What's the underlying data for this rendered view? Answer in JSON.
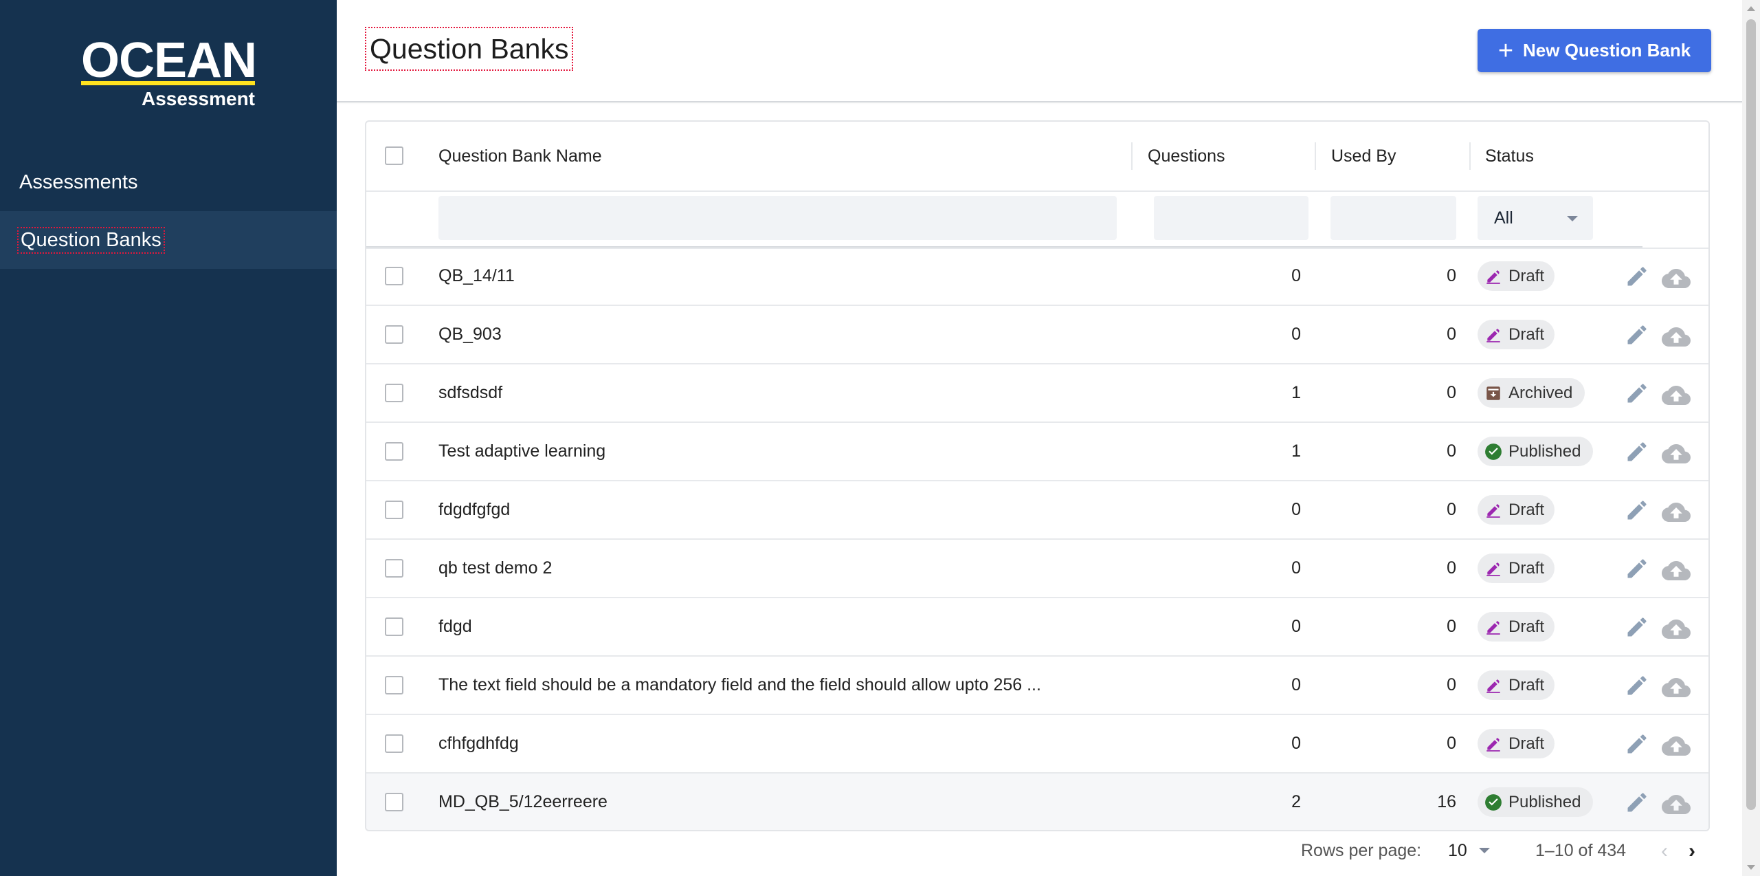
{
  "brand": {
    "name": "OCEAN",
    "tagline": "Assessment",
    "accent": "#ffe21f"
  },
  "sidebar": {
    "bg": "#15324f",
    "items": [
      {
        "label": "Assessments",
        "active": false
      },
      {
        "label": "Question Banks",
        "active": true
      }
    ]
  },
  "header": {
    "title": "Question Banks",
    "new_button_label": "New Question Bank",
    "new_button_icon": "plus-icon",
    "accent": "#3f6ee3"
  },
  "table": {
    "columns": [
      "Question Bank Name",
      "Questions",
      "Used By",
      "Status"
    ],
    "status_filter": "All",
    "rows": [
      {
        "name": "QB_14/11",
        "questions": "0",
        "used_by": "0",
        "status": "Draft"
      },
      {
        "name": "QB_903",
        "questions": "0",
        "used_by": "0",
        "status": "Draft"
      },
      {
        "name": "sdfsdsdf",
        "questions": "1",
        "used_by": "0",
        "status": "Archived"
      },
      {
        "name": "Test adaptive learning",
        "questions": "1",
        "used_by": "0",
        "status": "Published"
      },
      {
        "name": "fdgdfgfgd",
        "questions": "0",
        "used_by": "0",
        "status": "Draft"
      },
      {
        "name": "qb test demo 2",
        "questions": "0",
        "used_by": "0",
        "status": "Draft"
      },
      {
        "name": "fdgd",
        "questions": "0",
        "used_by": "0",
        "status": "Draft"
      },
      {
        "name": "The text field should be a mandatory field and the field should allow upto 256 ...",
        "questions": "0",
        "used_by": "0",
        "status": "Draft"
      },
      {
        "name": "cfhfgdhfdg",
        "questions": "0",
        "used_by": "0",
        "status": "Draft"
      },
      {
        "name": "MD_QB_5/12eerreere",
        "questions": "2",
        "used_by": "16",
        "status": "Published"
      }
    ],
    "status_colors": {
      "Draft": "#9c27b0",
      "Archived": "#795548",
      "Published": "#2e7d32"
    },
    "row_actions": [
      "edit-icon",
      "upload-cloud-icon"
    ]
  },
  "pagination": {
    "rows_per_page_label": "Rows per page:",
    "rows_per_page": "10",
    "range": "1–10 of 434"
  }
}
